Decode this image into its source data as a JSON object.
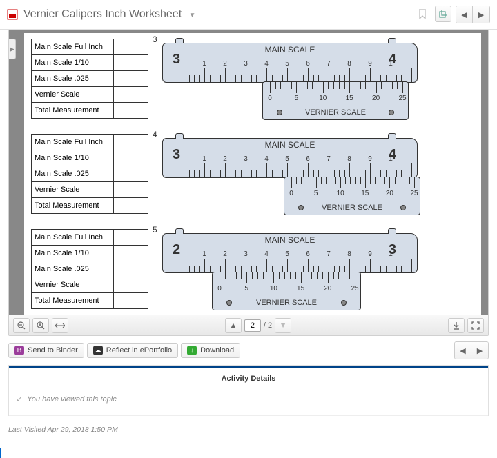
{
  "topbar": {
    "title": "Vernier Calipers Inch Worksheet"
  },
  "doc": {
    "rows": [
      {
        "number": "3",
        "tableRows": [
          "Main Scale Full Inch",
          "Main Scale 1/10",
          "Main Scale .025",
          "Vernier Scale",
          "Total Measurement"
        ],
        "caliper": {
          "leftBig": "3",
          "rightBig": "4",
          "mainLabel": "MAIN SCALE",
          "vernLabel": "VERNIER SCALE",
          "mainTicks": [
            "1",
            "2",
            "3",
            "4",
            "5",
            "6",
            "7",
            "8",
            "9",
            "1"
          ],
          "vernTicks": [
            "0",
            "5",
            "10",
            "15",
            "20",
            "25"
          ],
          "vernLeft": 145,
          "vernWidth": 212
        }
      },
      {
        "number": "4",
        "tableRows": [
          "Main Scale Full Inch",
          "Main Scale 1/10",
          "Main Scale .025",
          "Vernier Scale",
          "Total Measurement"
        ],
        "caliper": {
          "leftBig": "3",
          "rightBig": "4",
          "mainLabel": "MAIN SCALE",
          "vernLabel": "VERNIER SCALE",
          "mainTicks": [
            "1",
            "2",
            "3",
            "4",
            "5",
            "6",
            "7",
            "8",
            "9",
            "1"
          ],
          "vernTicks": [
            "0",
            "5",
            "10",
            "15",
            "20",
            "25"
          ],
          "vernLeft": 176,
          "vernWidth": 198
        }
      },
      {
        "number": "5",
        "tableRows": [
          "Main Scale Full Inch",
          "Main Scale 1/10",
          "Main Scale .025",
          "Vernier Scale",
          "Total Measurement"
        ],
        "caliper": {
          "leftBig": "2",
          "rightBig": "3",
          "mainLabel": "MAIN SCALE",
          "vernLabel": "VERNIER SCALE",
          "mainTicks": [
            "1",
            "2",
            "3",
            "4",
            "5",
            "6",
            "7",
            "8",
            "9",
            "1"
          ],
          "vernTicks": [
            "0",
            "5",
            "10",
            "15",
            "20",
            "25"
          ],
          "vernLeft": 72,
          "vernWidth": 216
        }
      }
    ]
  },
  "viewer": {
    "currentPage": "2",
    "totalPages": "/ 2"
  },
  "actions": {
    "binder": "Send to Binder",
    "reflect": "Reflect in ePortfolio",
    "download": "Download"
  },
  "activity": {
    "heading": "Activity Details",
    "viewed": "You have viewed this topic",
    "lastVisitedLabel": "Last Visited ",
    "lastVisitedTime": "Apr 29, 2018 1:50 PM"
  }
}
